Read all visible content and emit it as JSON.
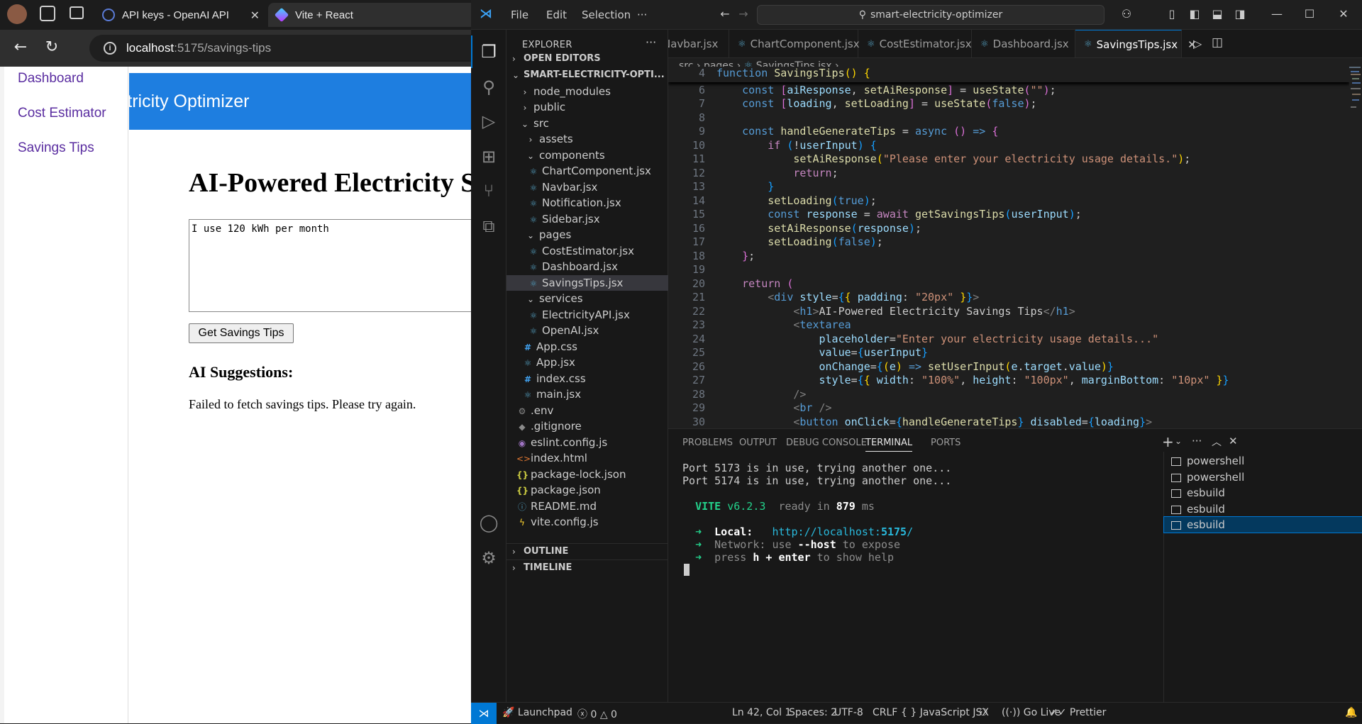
{
  "browser": {
    "tabs": [
      {
        "label": "API keys - OpenAI API"
      },
      {
        "label": "Vite + React"
      }
    ],
    "url_host": "localhost",
    "url_path": ":5175/savings-tips"
  },
  "webpage": {
    "sidebar": [
      "Dashboard",
      "Cost Estimator",
      "Savings Tips"
    ],
    "header_title": "Smart Electricity Optimizer",
    "h1": "AI-Powered Electricity Savings Tips",
    "textarea_value": "I use 120 kWh per month",
    "textarea_placeholder": "Enter your electricity usage details...",
    "button_label": "Get Savings Tips",
    "suggestions_heading": "AI Suggestions:",
    "suggestions_text": "Failed to fetch savings tips. Please try again."
  },
  "vscode": {
    "menu": [
      "File",
      "Edit",
      "Selection",
      "···"
    ],
    "search_text": "smart-electricity-optimizer",
    "explorer_title": "EXPLORER",
    "open_editors": "OPEN EDITORS",
    "project": "SMART-ELECTRICITY-OPTI...",
    "tree": [
      "node_modules",
      "public",
      "src",
      "assets",
      "components",
      "ChartComponent.jsx",
      "Navbar.jsx",
      "Notification.jsx",
      "Sidebar.jsx",
      "pages",
      "CostEstimator.jsx",
      "Dashboard.jsx",
      "SavingsTips.jsx",
      "services",
      "ElectricityAPI.jsx",
      "OpenAI.jsx",
      "App.css",
      "App.jsx",
      "index.css",
      "main.jsx",
      ".env",
      ".gitignore",
      "eslint.config.js",
      "index.html",
      "package-lock.json",
      "package.json",
      "README.md",
      "vite.config.js"
    ],
    "outline": "OUTLINE",
    "timeline": "TIMELINE",
    "editor_tabs": [
      "Navbar.jsx",
      "ChartComponent.jsx",
      "CostEstimator.jsx",
      "Dashboard.jsx",
      "SavingsTips.jsx"
    ],
    "breadcrumb": [
      "src",
      "pages",
      "SavingsTips.jsx",
      "..."
    ],
    "line_numbers": [
      "4",
      "6",
      "7",
      "8",
      "9",
      "10",
      "11",
      "12",
      "13",
      "14",
      "15",
      "16",
      "17",
      "18",
      "19",
      "20",
      "21",
      "22",
      "23",
      "24",
      "25",
      "26",
      "27",
      "28",
      "29",
      "30"
    ],
    "panel_tabs": [
      "PROBLEMS",
      "OUTPUT",
      "DEBUG CONSOLE",
      "TERMINAL",
      "PORTS"
    ],
    "terminal": {
      "line1": "Port 5173 is in use, trying another one...",
      "line2": "Port 5174 is in use, trying another one...",
      "vite": "VITE",
      "version": "v6.2.3",
      "ready": "ready in",
      "ms_value": "879",
      "ms": "ms",
      "arrow": "➜",
      "local_label": "Local:",
      "local_url": "http://localhost:",
      "local_port": "5175",
      "network_label": "Network:",
      "network_use": "use",
      "network_flag": "--host",
      "network_rest": "to expose",
      "press": "press",
      "press_key": "h + enter",
      "press_rest": "to show help"
    },
    "terminal_list": [
      "powershell",
      "powershell",
      "esbuild",
      "esbuild",
      "esbuild"
    ],
    "status": {
      "launchpad": "Launchpad",
      "errors": "0",
      "warnings": "0",
      "position": "Ln 42, Col 1",
      "spaces": "Spaces: 2",
      "encoding": "UTF-8",
      "eol": "CRLF",
      "language": "JavaScript JSX",
      "golive": "Go Live",
      "prettier": "Prettier"
    }
  },
  "colors": {
    "accent": "#0078d4",
    "app_header": "#1e7ee0",
    "sidebar_link": "#5a2da0"
  }
}
